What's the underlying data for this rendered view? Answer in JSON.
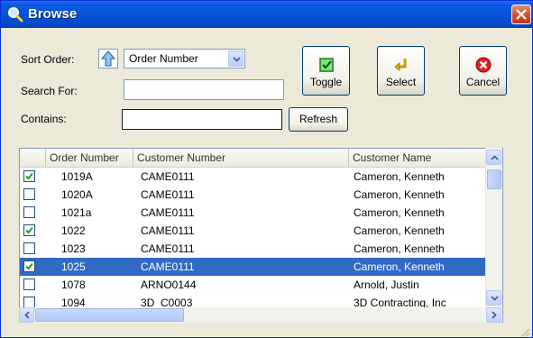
{
  "window": {
    "title": "Browse"
  },
  "form": {
    "sort_order_label": "Sort Order:",
    "sort_order_value": "Order Number",
    "search_for_label": "Search For:",
    "search_for_value": "",
    "contains_label": "Contains:",
    "contains_value": ""
  },
  "buttons": {
    "toggle": "Toggle",
    "select": "Select",
    "cancel": "Cancel",
    "refresh": "Refresh"
  },
  "grid": {
    "columns": [
      "Order Number",
      "Customer Number",
      "Customer Name"
    ],
    "rows": [
      {
        "checked": true,
        "selected": false,
        "order": "1019A",
        "customer_number": "CAME0111",
        "customer_name": "Cameron, Kenneth"
      },
      {
        "checked": false,
        "selected": false,
        "order": "1020A",
        "customer_number": "CAME0111",
        "customer_name": "Cameron, Kenneth"
      },
      {
        "checked": false,
        "selected": false,
        "order": "1021a",
        "customer_number": "CAME0111",
        "customer_name": "Cameron, Kenneth"
      },
      {
        "checked": true,
        "selected": false,
        "order": "1022",
        "customer_number": "CAME0111",
        "customer_name": "Cameron, Kenneth"
      },
      {
        "checked": false,
        "selected": false,
        "order": "1023",
        "customer_number": "CAME0111",
        "customer_name": "Cameron, Kenneth"
      },
      {
        "checked": true,
        "selected": true,
        "order": "1025",
        "customer_number": "CAME0111",
        "customer_name": "Cameron, Kenneth"
      },
      {
        "checked": false,
        "selected": false,
        "order": "1078",
        "customer_number": "ARNO0144",
        "customer_name": "Arnold, Justin"
      },
      {
        "checked": false,
        "selected": false,
        "order": "1094",
        "customer_number": "3D_C0003",
        "customer_name": "3D Contracting, Inc"
      }
    ]
  },
  "colors": {
    "titlebar": "#0654d9",
    "selection": "#316ac5",
    "window_bg": "#ece9d8"
  },
  "icons": {
    "title": "magnifier-icon",
    "close": "close-x-icon",
    "sort": "up-arrow-icon",
    "toggle": "green-check-icon",
    "select": "enter-arrow-icon",
    "cancel": "red-x-icon"
  }
}
